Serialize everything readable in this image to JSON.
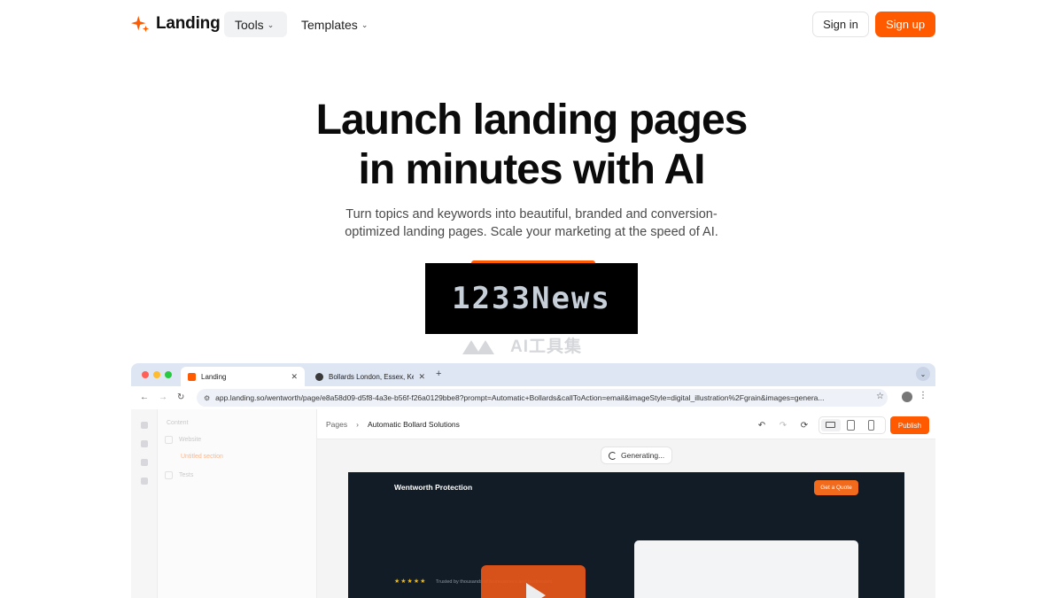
{
  "nav": {
    "logo_text": "Landing",
    "tools_label": "Tools",
    "templates_label": "Templates",
    "signin_label": "Sign in",
    "signup_label": "Sign up"
  },
  "hero": {
    "title_line1": "Launch landing pages",
    "title_line2": "in minutes with AI",
    "subtitle": "Turn topics and keywords into beautiful, branded and conversion-optimized landing pages. Scale your marketing at the speed of AI."
  },
  "watermark": {
    "text": "1233News",
    "text2": "AI工具集"
  },
  "browser": {
    "tab1": "Landing",
    "tab2": "Bollards London, Essex, Kent",
    "url": "app.landing.so/wentworth/page/e8a58d09-d5f8-4a3e-b56f-f26a0129bbe8?prompt=Automatic+Bollards&callToAction=email&imageStyle=digital_illustration%2Fgrain&images=genera..."
  },
  "app": {
    "crumb_root": "Pages",
    "crumb_current": "Automatic Bollard Solutions",
    "publish_label": "Publish",
    "generating_label": "Generating...",
    "panel": {
      "section": "Content",
      "item1": "Website",
      "item2": "Untitled section",
      "item3": "Tests"
    }
  },
  "preview": {
    "brand": "Wentworth Protection",
    "quote_button": "Get a Quote",
    "stars": "★★★★★",
    "trust_text": "Trusted by thousands of homeowners and businesses"
  },
  "colors": {
    "brand_orange": "#ff5a00",
    "preview_bg": "#111c26"
  }
}
